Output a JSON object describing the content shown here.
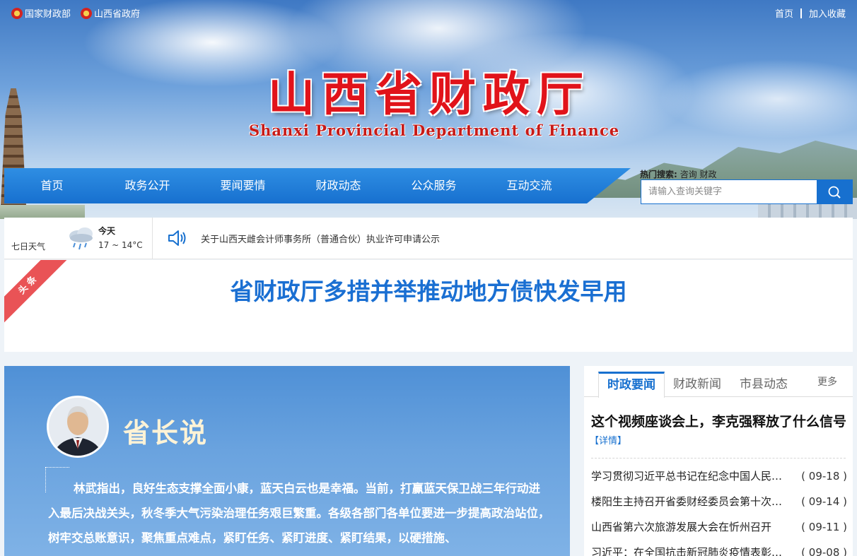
{
  "top_links": {
    "left": [
      {
        "label": "国家财政部",
        "icon": "national-emblem-icon"
      },
      {
        "label": "山西省政府",
        "icon": "national-emblem-icon"
      }
    ],
    "right": [
      "首页",
      "加入收藏"
    ]
  },
  "site": {
    "title": "山西省财政厅",
    "subtitle": "Shanxi Provincial Department of Finance"
  },
  "nav": [
    "首页",
    "政务公开",
    "要闻要情",
    "财政动态",
    "公众服务",
    "互动交流"
  ],
  "search": {
    "hot_label": "热门搜索:",
    "hot_terms": "咨询 财政",
    "placeholder": "请输入查询关键字",
    "icon": "search-icon"
  },
  "weather": {
    "label": "七日天气",
    "today": "今天",
    "temp": "17 ~ 14°C",
    "icon": "rain-cloud-icon"
  },
  "notice": {
    "icon": "speaker-icon",
    "text": "关于山西天雌会计师事务所（普通合伙）执业许可申请公示"
  },
  "headline": {
    "ribbon": "头条",
    "title": "省财政厅多措并举推动地方债快发早用"
  },
  "governor": {
    "title": "省长说",
    "text": "林武指出，良好生态支撑全面小康，蓝天白云也是幸福。当前，打赢蓝天保卫战三年行动进入最后决战关头，秋冬季大气污染治理任务艰巨繁重。各级各部门各单位要进一步提高政治站位，树牢交总账意识，聚焦重点难点，紧盯任务、紧盯进度、紧盯结果，以硬措施、"
  },
  "news": {
    "tabs": [
      "时政要闻",
      "财政新闻",
      "市县动态"
    ],
    "active_tab": 0,
    "more": "更多",
    "top_title": "这个视频座谈会上，李克强释放了什么信号",
    "detail": "【详情】",
    "items": [
      {
        "title": "学习贯彻习近平总书记在纪念中国人民抗日战争胜利75周年座谈会上重要讲话",
        "date": "( 09-18 )"
      },
      {
        "title": "楼阳生主持召开省委财经委员会第十次会议",
        "date": "( 09-14 )"
      },
      {
        "title": "山西省第六次旅游发展大会在忻州召开",
        "date": "( 09-11 )"
      },
      {
        "title": "习近平：在全国抗击新冠肺炎疫情表彰大会上的讲话",
        "date": "( 09-08 )"
      }
    ]
  },
  "colors": {
    "nav_blue": "#1770cf",
    "title_red": "#e1131a",
    "headline_blue": "#1a6fd2",
    "ribbon_red": "#e95356"
  }
}
